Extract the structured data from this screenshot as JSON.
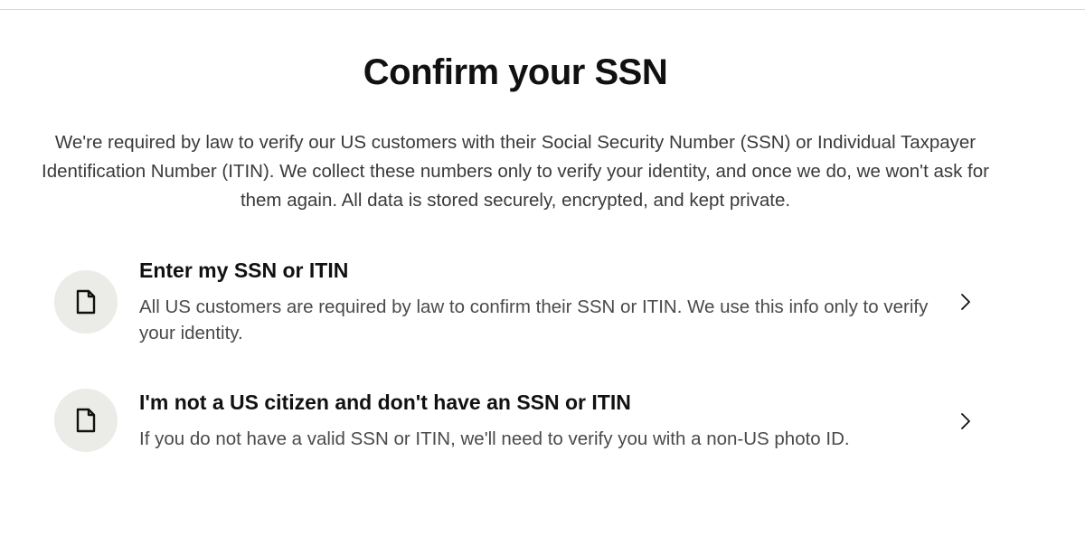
{
  "page": {
    "title": "Confirm your SSN",
    "intro": "We're required by law to verify our US customers with their Social Security Number (SSN) or Individual Taxpayer Identification Number (ITIN). We collect these numbers only to verify your identity, and once we do, we won't ask for them again. All data is stored securely, encrypted, and kept private."
  },
  "options": [
    {
      "title": "Enter my SSN or ITIN",
      "description": "All US customers are required by law to confirm their SSN or ITIN. We use this info only to verify your identity.",
      "icon": "document-icon",
      "action_icon": "chevron-right-icon"
    },
    {
      "title": "I'm not a US citizen and don't have an SSN or ITIN",
      "description": "If you do not have a valid SSN or ITIN, we'll need to verify you with a non-US photo ID.",
      "icon": "document-icon",
      "action_icon": "chevron-right-icon"
    }
  ],
  "colors": {
    "icon_background": "#ebece8",
    "text_primary": "#111111",
    "text_secondary": "#4a4a4a"
  }
}
